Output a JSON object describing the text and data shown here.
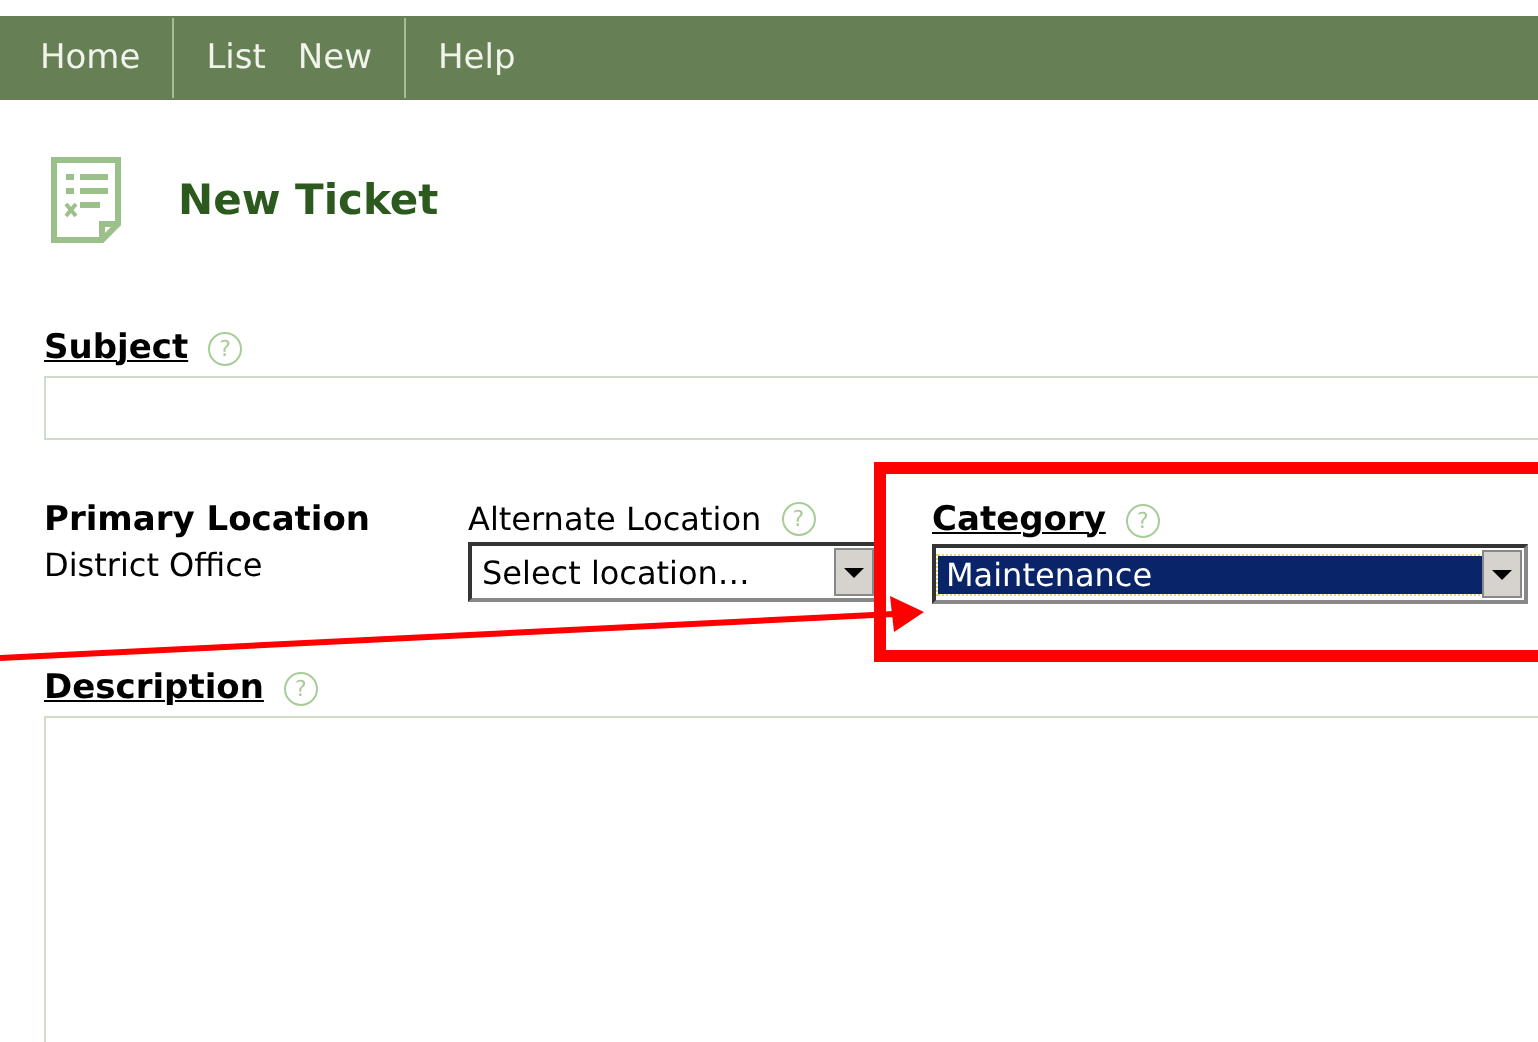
{
  "nav": {
    "groups": [
      [
        "Home"
      ],
      [
        "List",
        "New"
      ],
      [
        "Help"
      ]
    ]
  },
  "page": {
    "title": "New Ticket"
  },
  "subject": {
    "label": "Subject",
    "help": "?"
  },
  "primary_location": {
    "label": "Primary Location",
    "value": "District Office"
  },
  "alternate_location": {
    "label": "Alternate Location",
    "help": "?",
    "value": "Select location…",
    "highlighted": false
  },
  "category": {
    "label": "Category",
    "help": "?",
    "value": "Maintenance",
    "highlighted": true
  },
  "description": {
    "label": "Description",
    "help": "?"
  }
}
